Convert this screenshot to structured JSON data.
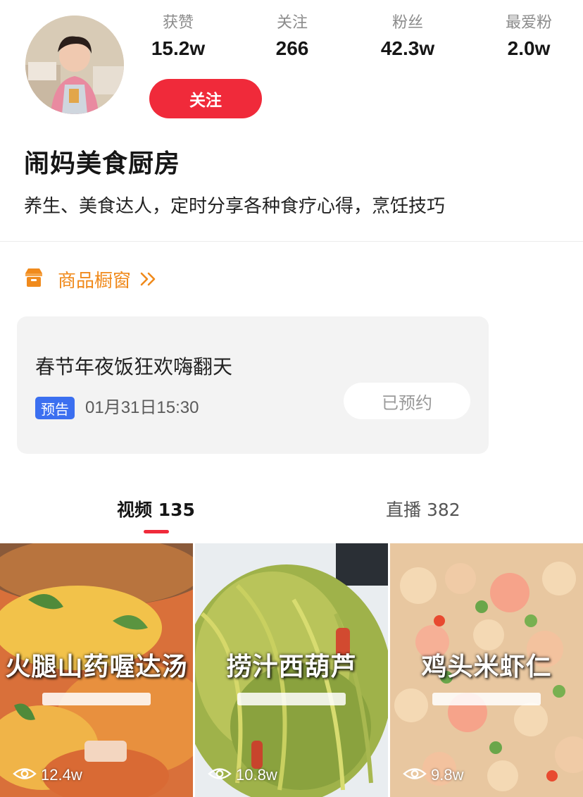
{
  "stats": [
    {
      "label": "获赞",
      "value": "15.2w"
    },
    {
      "label": "关注",
      "value": "266"
    },
    {
      "label": "粉丝",
      "value": "42.3w"
    },
    {
      "label": "最爱粉",
      "value": "2.0w"
    }
  ],
  "follow_label": "关注",
  "profile": {
    "name": "闹妈美食厨房",
    "bio": "养生、美食达人，定时分享各种食疗心得，烹饪技巧"
  },
  "shop": {
    "label": "商品橱窗",
    "icon": "shop-icon"
  },
  "live": {
    "title": "春节年夜饭狂欢嗨翻天",
    "tag": "预告",
    "time": "01月31日15:30",
    "reserve_label": "已预约"
  },
  "tabs": [
    {
      "label": "视频 135"
    },
    {
      "label": "直播 382"
    }
  ],
  "videos": [
    {
      "title": "火腿山药喔达汤",
      "views": "12.4w"
    },
    {
      "title": "捞汁西葫芦",
      "views": "10.8w"
    },
    {
      "title": "鸡头米虾仁",
      "views": "9.8w"
    }
  ],
  "colors": {
    "accent": "#f02a3a",
    "shop": "#f08a1c",
    "tag": "#3b6ff0"
  }
}
